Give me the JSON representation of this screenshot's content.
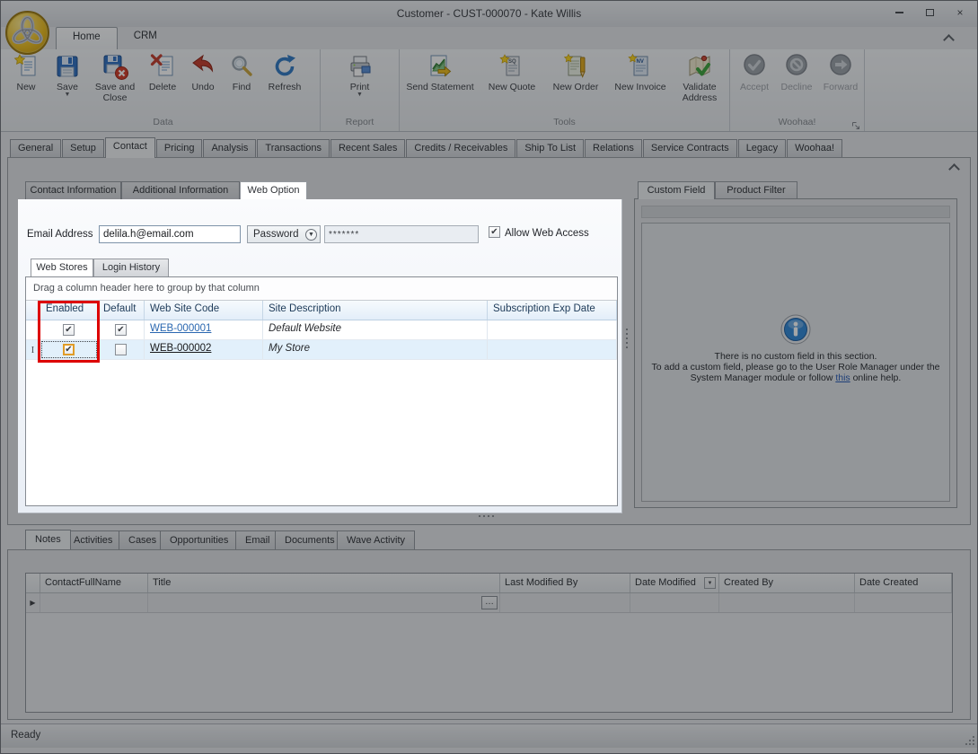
{
  "window": {
    "title": "Customer - CUST-000070 - Kate Willis",
    "status": "Ready"
  },
  "ribbon": {
    "tabs": [
      {
        "label": "Home"
      },
      {
        "label": "CRM"
      }
    ],
    "groups": [
      {
        "label": "Data"
      },
      {
        "label": "Report"
      },
      {
        "label": "Tools"
      },
      {
        "label": "Woohaa!"
      }
    ],
    "buttons": {
      "new": "New",
      "save": "Save",
      "save_and_close": "Save and Close",
      "delete": "Delete",
      "undo": "Undo",
      "find": "Find",
      "refresh": "Refresh",
      "print": "Print",
      "send_statement": "Send Statement",
      "new_quote": "New Quote",
      "new_order": "New Order",
      "new_invoice": "New Invoice",
      "validate_address": "Validate Address",
      "accept": "Accept",
      "decline": "Decline",
      "forward": "Forward"
    }
  },
  "main_tabs": [
    "General",
    "Setup",
    "Contact",
    "Pricing",
    "Analysis",
    "Transactions",
    "Recent Sales",
    "Credits / Receivables",
    "Ship To List",
    "Relations",
    "Service Contracts",
    "Legacy",
    "Woohaa!"
  ],
  "contact_tabs": [
    "Contact Information",
    "Additional Information",
    "Web Option"
  ],
  "web_option": {
    "email_label": "Email Address",
    "email_value": "delila.h@email.com",
    "password_selector": "Password",
    "password_value": "*******",
    "allow_web_access_label": "Allow Web Access",
    "allow_web_access_check": "✔",
    "tabs": [
      "Web Stores",
      "Login History"
    ],
    "grid": {
      "group_hint": "Drag a column header here to group by that column",
      "columns": [
        "Enabled",
        "Default",
        "Web Site Code",
        "Site Description",
        "Subscription Exp Date"
      ],
      "rows": [
        {
          "enabled": "✔",
          "default": "✔",
          "code": "WEB-000001",
          "description": "Default Website",
          "exp_date": ""
        },
        {
          "enabled": "✔",
          "default": "",
          "code": "WEB-000002",
          "description": "My Store",
          "exp_date": ""
        }
      ]
    }
  },
  "custom_field": {
    "tabs": [
      "Custom Field",
      "Product Filter"
    ],
    "line1": "There is no custom field in this section.",
    "line2": "To add a custom field, please go to the User Role Manager under the",
    "line3_pre": "System Manager module or follow ",
    "line3_link": "this",
    "line3_post": " online help."
  },
  "bottom": {
    "tabs": [
      "Notes",
      "Activities",
      "Cases",
      "Opportunities",
      "Email",
      "Documents",
      "Wave Activity"
    ],
    "columns": [
      "ContactFullName",
      "Title",
      "Last Modified By",
      "Date Modified",
      "Created By",
      "Date Created"
    ],
    "ellipsis": "…"
  },
  "colors": {
    "highlight_red": "#dd0000",
    "link_blue": "#2a67b0",
    "focus_orange": "#e09c28",
    "info_blue": "#2f86d6",
    "selection_blue": "#e2f0fb"
  }
}
